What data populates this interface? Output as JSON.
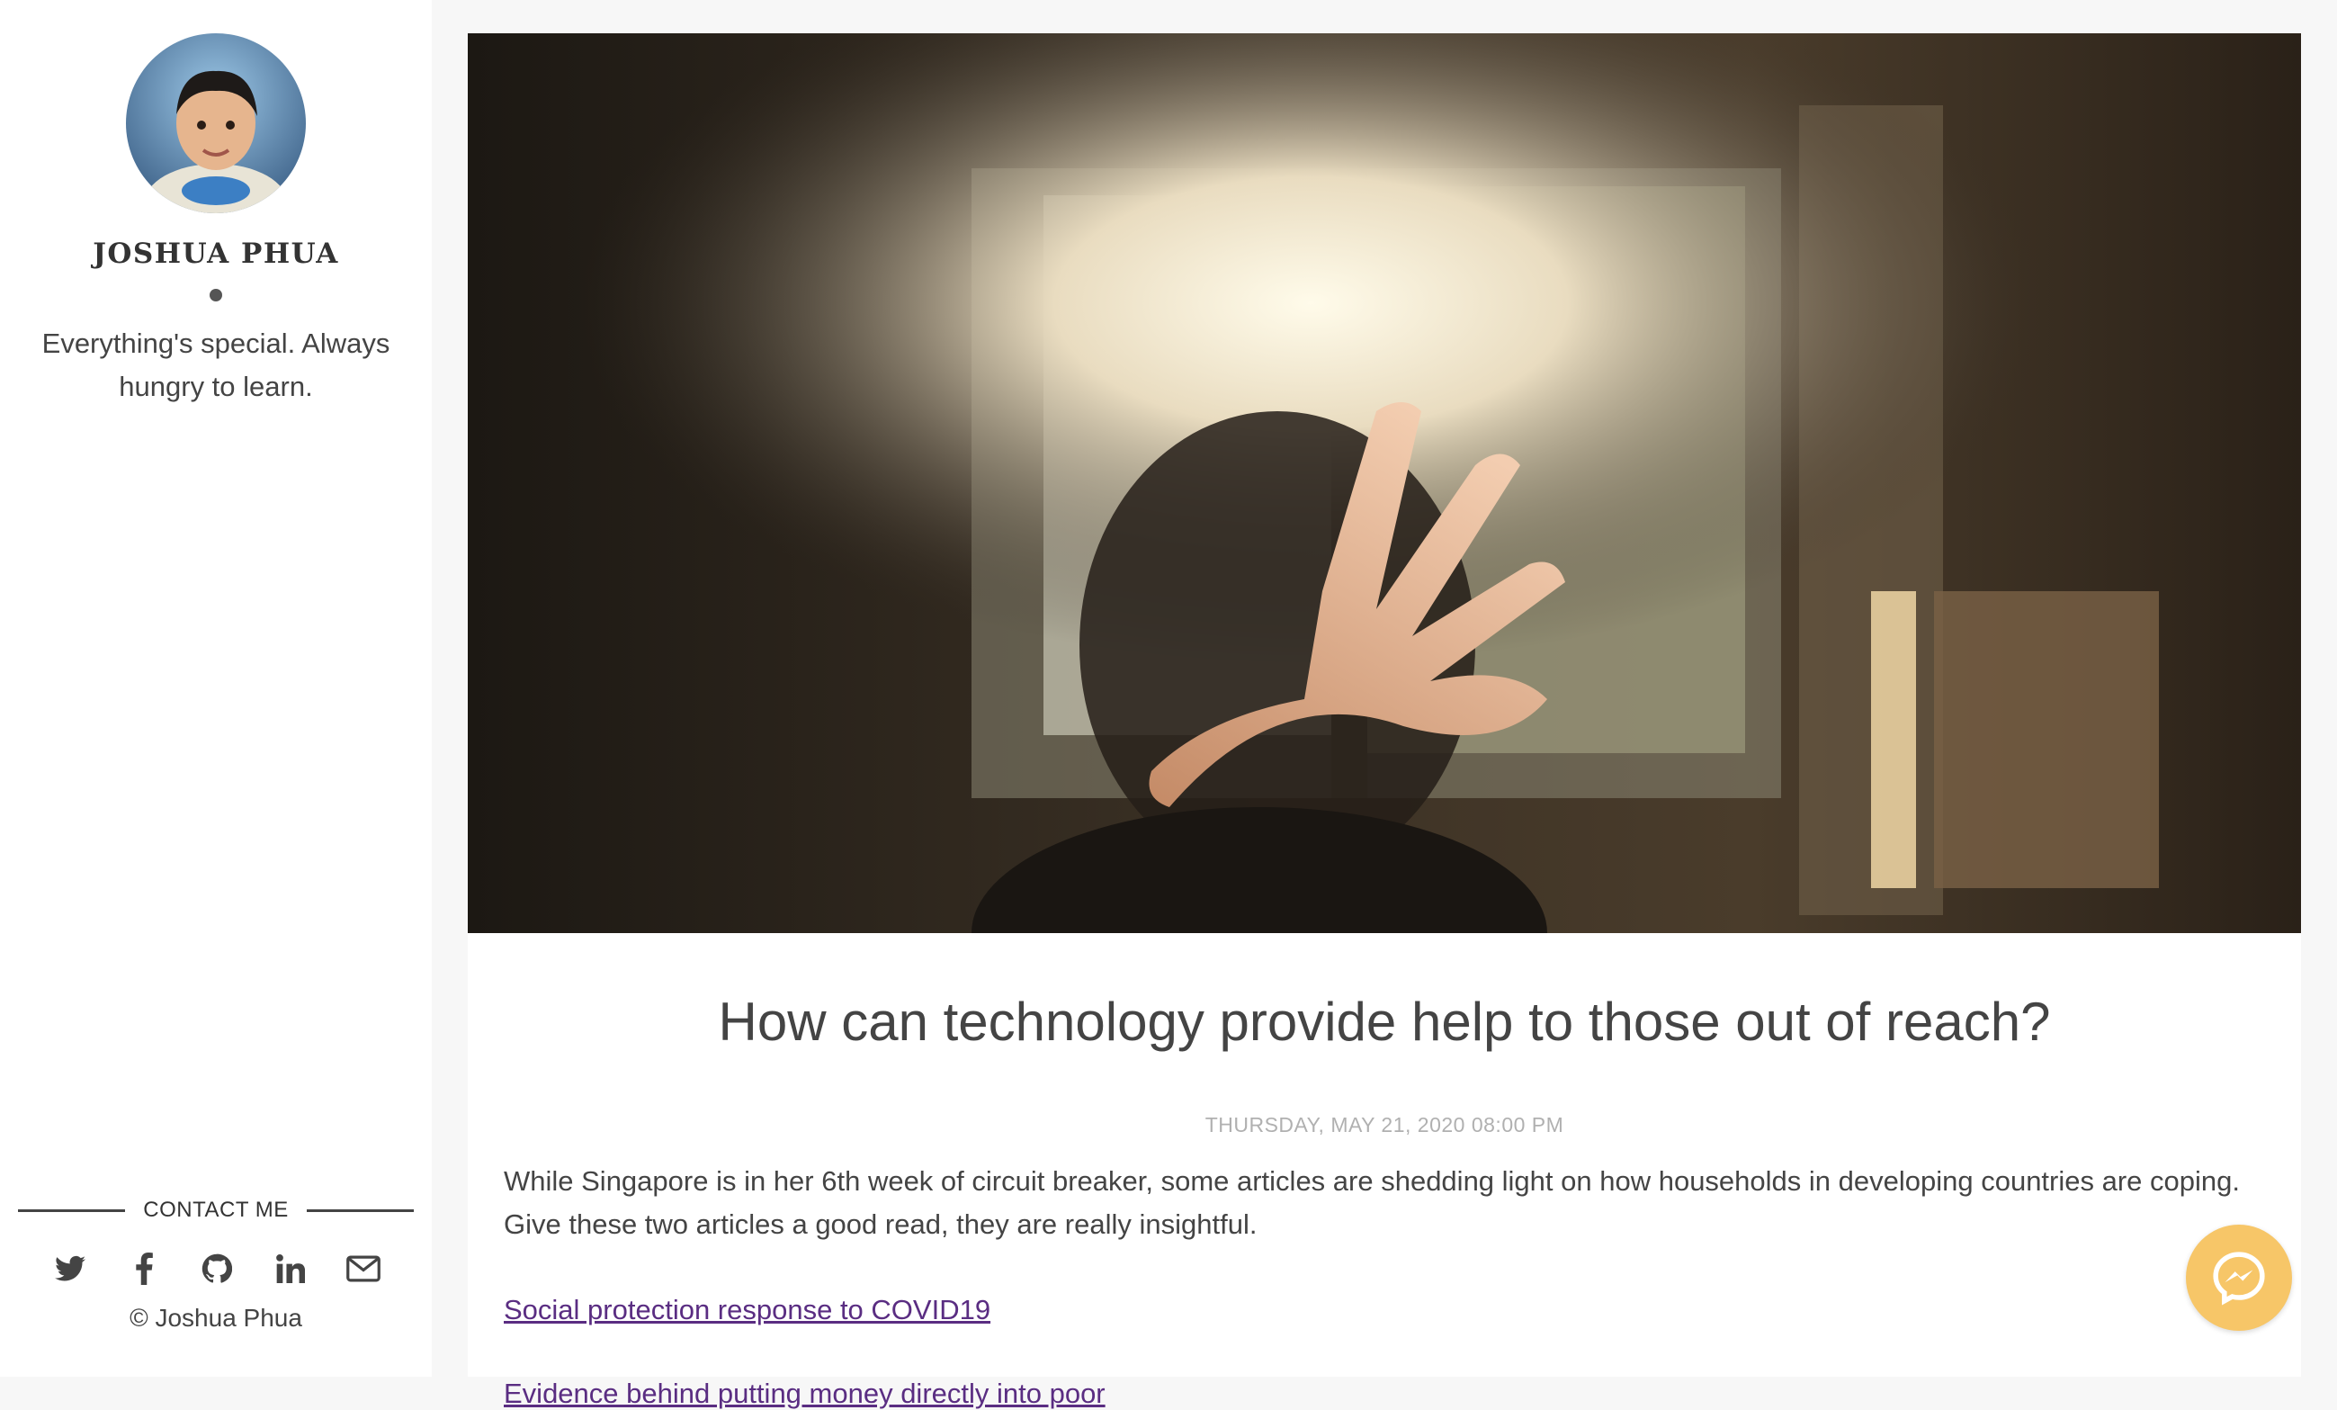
{
  "sidebar": {
    "author_name": "JOSHUA PHUA",
    "tagline": "Everything's special. Always hungry to learn.",
    "contact_heading": "CONTACT ME",
    "social_icons": [
      "twitter-icon",
      "facebook-icon",
      "github-icon",
      "linkedin-icon",
      "mail-icon"
    ],
    "copyright": "© Joshua Phua"
  },
  "post": {
    "title": "How can technology provide help to those out of reach?",
    "date": "THURSDAY, MAY 21, 2020 08:00 PM",
    "intro": "While Singapore is in her 6th week of circuit breaker, some articles are shedding light on how households in developing countries are coping. Give these two articles a good read, they are really insightful.",
    "links": [
      "Social protection response to COVID19",
      "Evidence behind putting money directly into poor"
    ]
  },
  "chat_widget": {
    "icon": "messenger-icon"
  },
  "colors": {
    "link": "#5a2d82",
    "text": "#444444",
    "date": "#b0b0b0",
    "messenger_bubble": "#f7c668"
  }
}
